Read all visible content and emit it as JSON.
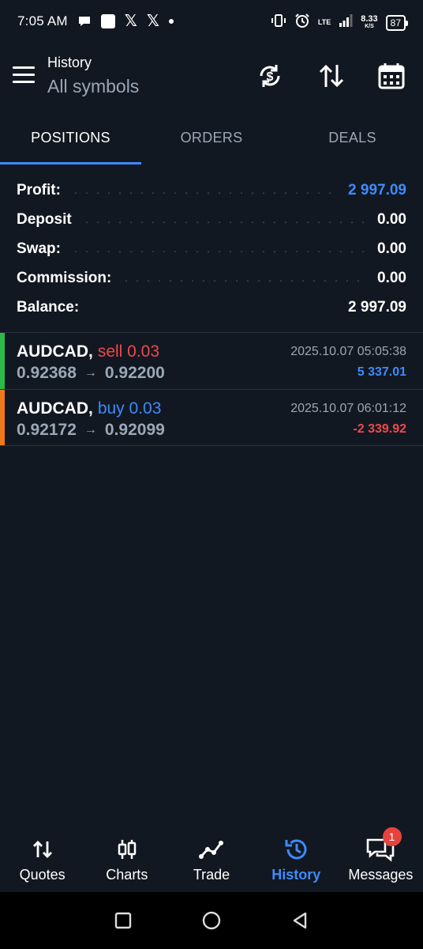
{
  "status_bar": {
    "time": "7:05 AM",
    "lte_label": "LTE",
    "net_speed_value": "8.33",
    "net_speed_unit": "K/S",
    "battery": "87"
  },
  "header": {
    "title": "History",
    "subtitle": "All symbols",
    "icons": [
      "currency-sync-icon",
      "sort-icon",
      "calendar-icon"
    ]
  },
  "tabs": [
    {
      "label": "POSITIONS",
      "active": true
    },
    {
      "label": "ORDERS",
      "active": false
    },
    {
      "label": "DEALS",
      "active": false
    }
  ],
  "summary": [
    {
      "label": "Profit:",
      "value": "2 997.09"
    },
    {
      "label": "Deposit",
      "value": "0.00"
    },
    {
      "label": "Swap:",
      "value": "0.00"
    },
    {
      "label": "Commission:",
      "value": "0.00"
    },
    {
      "label": "Balance:",
      "value": "2 997.09"
    }
  ],
  "positions": [
    {
      "symbol": "AUDCAD,",
      "type": "sell 0.03",
      "open_price": "0.92368",
      "arrow": "→",
      "close_price": "0.92200",
      "time": "2025.10.07 05:05:38",
      "profit": "5 337.01"
    },
    {
      "symbol": "AUDCAD,",
      "type": "buy 0.03",
      "open_price": "0.92172",
      "arrow": "→",
      "close_price": "0.92099",
      "time": "2025.10.07 06:01:12",
      "profit": "-2 339.92"
    }
  ],
  "bottom_nav": [
    {
      "label": "Quotes",
      "icon": "quotes-arrows-icon"
    },
    {
      "label": "Charts",
      "icon": "candlestick-icon"
    },
    {
      "label": "Trade",
      "icon": "trend-line-icon"
    },
    {
      "label": "History",
      "icon": "history-clock-icon"
    },
    {
      "label": "Messages",
      "icon": "chat-bubbles-icon",
      "badge": "1"
    }
  ],
  "colors": {
    "background": "#121821",
    "accent_blue": "#3d8bfd",
    "sell_red": "#f0484d",
    "muted_text": "#9aa7b6",
    "buy_bar": "#2eb84a",
    "sell_bar": "#f07a1a"
  }
}
